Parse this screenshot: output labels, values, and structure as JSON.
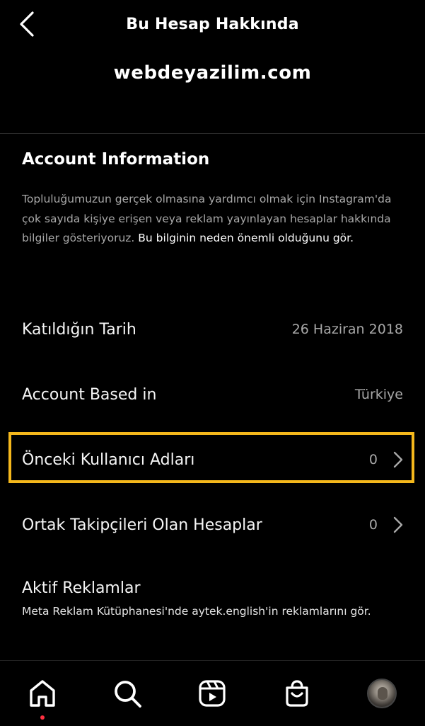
{
  "header": {
    "title": "Bu Hesap Hakkında",
    "username": "webdeyazilim.com"
  },
  "section": {
    "title": "Account Information",
    "description": "Topluluğumuzun gerçek olmasına yardımcı olmak için Instagram'da çok sayıda kişiye erişen veya reklam yayınlayan hesaplar hakkında bilgiler gösteriyoruz.",
    "link_text": "Bu bilginin neden önemli olduğunu gör."
  },
  "rows": [
    {
      "label": "Katıldığın Tarih",
      "value": "26 Haziran 2018"
    },
    {
      "label": "Account Based in",
      "value": "Türkiye"
    },
    {
      "label": "Önceki Kullanıcı Adları",
      "value": "0"
    },
    {
      "label": "Ortak Takipçileri Olan Hesaplar",
      "value": "0"
    }
  ],
  "ads": {
    "title": "Aktif Reklamlar",
    "description": "Meta Reklam Kütüphanesi'nde aytek.english'in reklamlarını gör."
  },
  "nav": {
    "items": [
      "home-icon",
      "search-icon",
      "reels-icon",
      "shop-icon",
      "profile-avatar"
    ],
    "active": "home-icon"
  },
  "colors": {
    "background": "#000000",
    "highlight": "#f5b81c",
    "secondary_text": "#a8a8a8",
    "notification_dot": "#ff3040"
  }
}
